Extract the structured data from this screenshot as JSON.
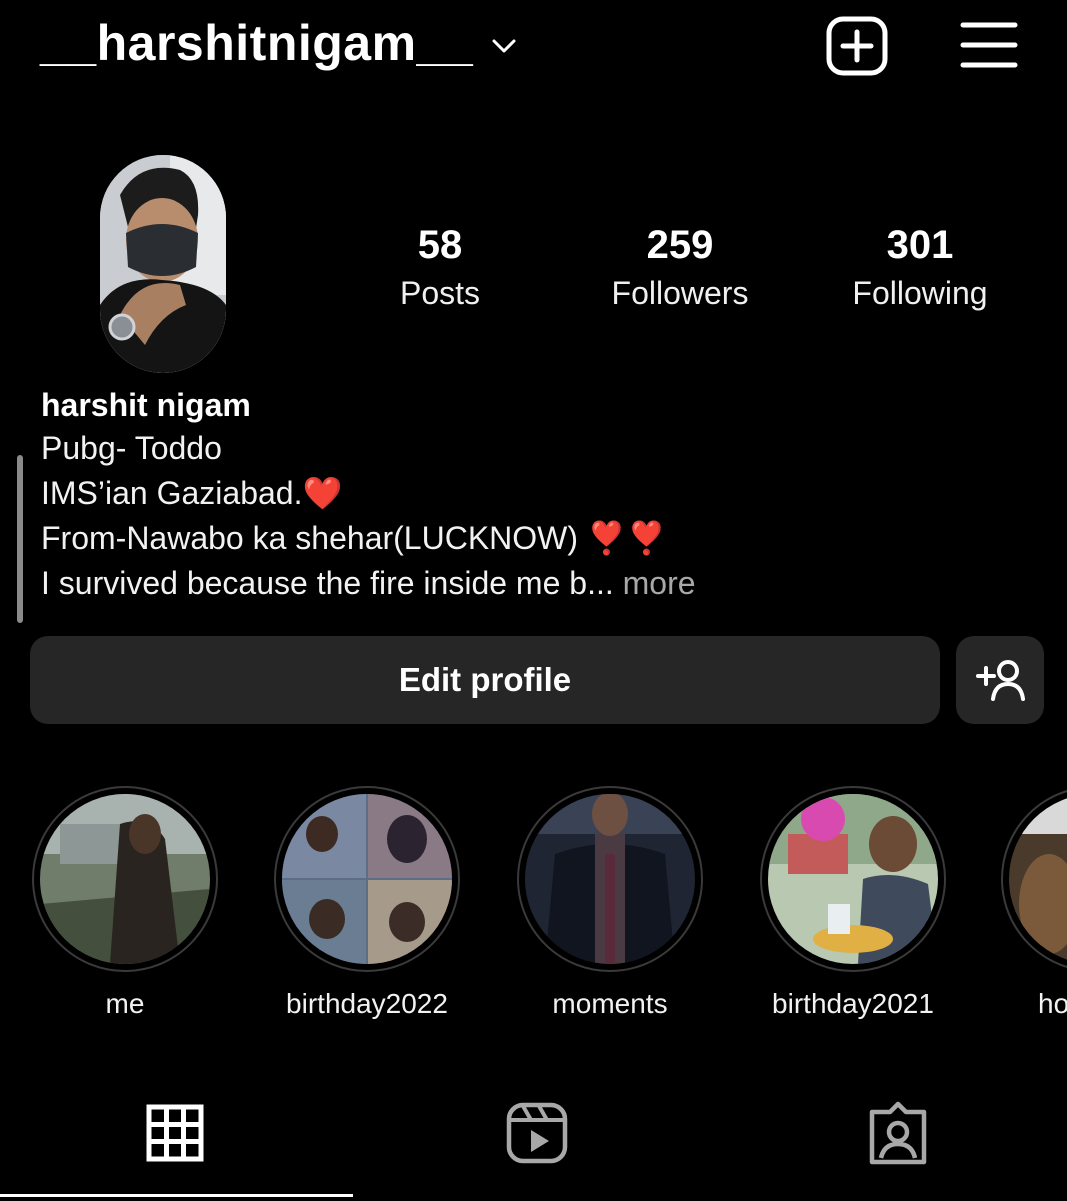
{
  "header": {
    "username": "__harshitnigam__",
    "icons": {
      "dropdown": "chevron-down-icon",
      "create": "plus-square-icon",
      "menu": "hamburger-menu-icon"
    }
  },
  "stats": [
    {
      "value": "58",
      "label": "Posts"
    },
    {
      "value": "259",
      "label": "Followers"
    },
    {
      "value": "301",
      "label": "Following"
    }
  ],
  "bio": {
    "name": "harshit nigam",
    "lines": [
      "Pubg- Toddo",
      "IMS’ian Gaziabad.❤️",
      "From-Nawabo ka shehar(LUCKNOW) ❣️❣️",
      "I survived because the fire inside me b..."
    ],
    "more_label": " more"
  },
  "actions": {
    "edit_profile": "Edit profile",
    "discover_icon": "add-person-icon"
  },
  "highlights": [
    {
      "label": "me"
    },
    {
      "label": "birthday2022"
    },
    {
      "label": "moments"
    },
    {
      "label": "birthday2021"
    },
    {
      "label": "ho"
    }
  ],
  "tabs": [
    {
      "name": "posts-grid-icon",
      "active": true
    },
    {
      "name": "reels-icon",
      "active": false
    },
    {
      "name": "tagged-icon",
      "active": false
    }
  ],
  "colors": {
    "background": "#000000",
    "button_bg": "#262626",
    "muted_text": "#a8a8a8",
    "heart": "#e0322f"
  }
}
